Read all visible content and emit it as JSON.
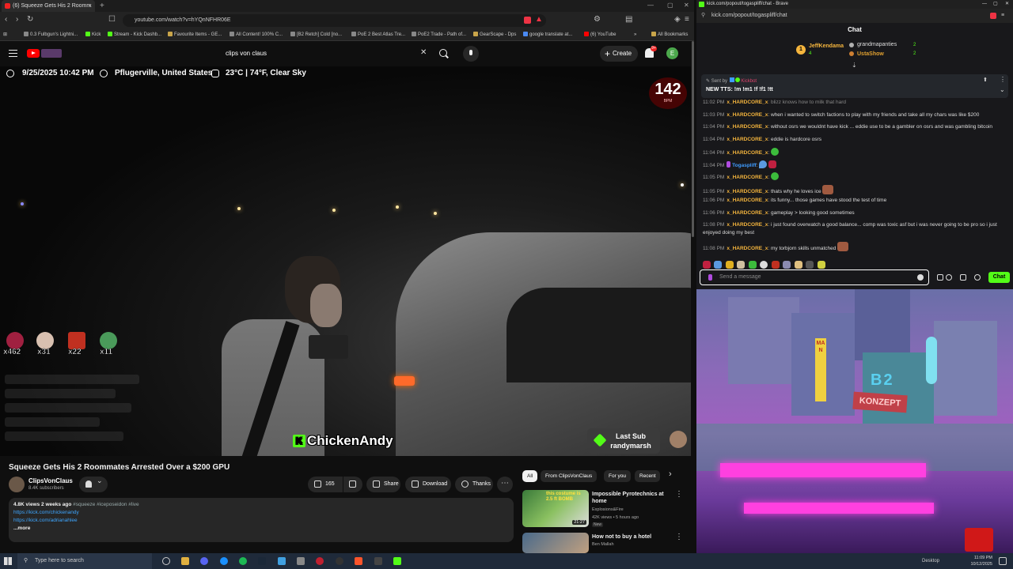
{
  "left_browser": {
    "tab_title": "(6) Squeeze Gets His 2 Roomm",
    "url": "youtube.com/watch?v=hYQnNFHR06E",
    "bookmarks": [
      "0.3 Fulbgun's Lightni...",
      "Kick",
      "Stream - Kick Dashb...",
      "Favourite Items - GE...",
      "All Content! 100% C...",
      "[B2 Retch] Cold [no...",
      "PoE 2 Best Atlas Tre...",
      "PoE2 Trade - Path of...",
      "GearScape - Dps",
      "google translate at...",
      "(6) YouTube",
      "All Bookmarks"
    ]
  },
  "youtube": {
    "search_value": "clips von claus",
    "create_label": "Create",
    "notification_count": "9+",
    "avatar_letter": "E",
    "video_overlay": {
      "datetime": "9/25/2025 10:42 PM",
      "location": "Pflugerville, United States",
      "weather": "23°C | 74°F, Clear Sky",
      "bpm_value": "142",
      "bpm_label": "BPM",
      "sub_counts": [
        "x462",
        "x31",
        "x22",
        "x11"
      ],
      "streamer_name": "ChickenAndy",
      "last_sub_label": "Last Sub",
      "last_sub_name": "randymarsh"
    },
    "video_title": "Squeeze Gets His 2 Roommates Arrested Over a $200 GPU",
    "channel_name": "ClipsVonClaus",
    "channel_subs": "8.4K subscribers",
    "like_count": "165",
    "share_label": "Share",
    "download_label": "Download",
    "thanks_label": "Thanks",
    "description": {
      "meta": "4.8K views  2 weeks ago",
      "tags": "#squeeze #iceposeidon #live",
      "link1": "https://kick.com/chickenandy",
      "link2": "https://kick.com/adrianahlee",
      "more": "...more"
    },
    "chips": [
      "All",
      "From ClipsVonClaus",
      "For you",
      "Recent"
    ],
    "recommendations": [
      {
        "thumb_text": "this costume is 2.5 ft BOMB",
        "title": "Impossible Pyrotechnics at home",
        "channel": "Explosions&Fire",
        "meta": "42K views • 5 hours ago",
        "badge": "New",
        "duration": "21:27"
      },
      {
        "title": "How not to buy a hotel",
        "channel": "Ben Mallah"
      }
    ]
  },
  "kick_chat": {
    "window_title": "kick.com/popout/togaspliff/chat - Brave",
    "url": "kick.com/popout/togaspliff/chat",
    "header": "Chat",
    "leaderboard": [
      {
        "rank": "1",
        "name": "JeffKendama",
        "count": "4"
      },
      {
        "name": "grandmapanties",
        "count": "2"
      },
      {
        "name": "UstaShow",
        "count": "2"
      }
    ],
    "pinned": {
      "sent_by_label": "Sent by",
      "sent_by_name": "Kickbot",
      "message": "NEW TTS: !m !m1 !f !f1 !tt"
    },
    "messages": [
      {
        "ts": "11:02 PM",
        "user": "x_HARDCORE_x",
        "text": "blizz knows how to milk that hard"
      },
      {
        "ts": "11:03 PM",
        "user": "x_HARDCORE_x",
        "text": "when i wanted to switch factions to play with my friends and take all my chars was like $200"
      },
      {
        "ts": "11:04 PM",
        "user": "x_HARDCORE_x",
        "text": "without osrs we wouldnt have kick ... eddie use to be a gambler on osrs and was gambling bitcoin"
      },
      {
        "ts": "11:04 PM",
        "user": "x_HARDCORE_x",
        "text": "eddie is hardcore osrs"
      },
      {
        "ts": "11:04 PM",
        "user": "x_HARDCORE_x",
        "text": ""
      },
      {
        "ts": "11:04 PM",
        "user": "Togaspliff",
        "text": ""
      },
      {
        "ts": "11:05 PM",
        "user": "x_HARDCORE_x",
        "text": ""
      },
      {
        "ts": "11:05 PM",
        "user": "x_HARDCORE_x",
        "text": "thats why he loves ice"
      },
      {
        "ts": "11:06 PM",
        "user": "x_HARDCORE_x",
        "text": "its funny... those games have stood the test of time"
      },
      {
        "ts": "11:06 PM",
        "user": "x_HARDCORE_x",
        "text": "gameplay > looking good sometimes"
      },
      {
        "ts": "11:08 PM",
        "user": "x_HARDCORE_x",
        "text": "i just found overwatch a good balance... comp was toxic asf but i was never going to be pro so i just enjoyed doing my best"
      },
      {
        "ts": "11:08 PM",
        "user": "x_HARDCORE_x",
        "text": "my torbjorn skills unmatched"
      }
    ],
    "input_placeholder": "Send a message",
    "send_label": "Chat"
  },
  "game": {
    "sign_man": "MAN",
    "sign_b2": "B2",
    "sign_konzept": "KONZEPT"
  },
  "taskbar": {
    "search_placeholder": "Type here to search",
    "desktop_label": "Desktop",
    "time": "11:09 PM",
    "date": "10/12/2025"
  },
  "colors": {
    "kick_green": "#53fc18",
    "youtube_red": "#ff0000",
    "username_gold": "#f5b53d"
  }
}
